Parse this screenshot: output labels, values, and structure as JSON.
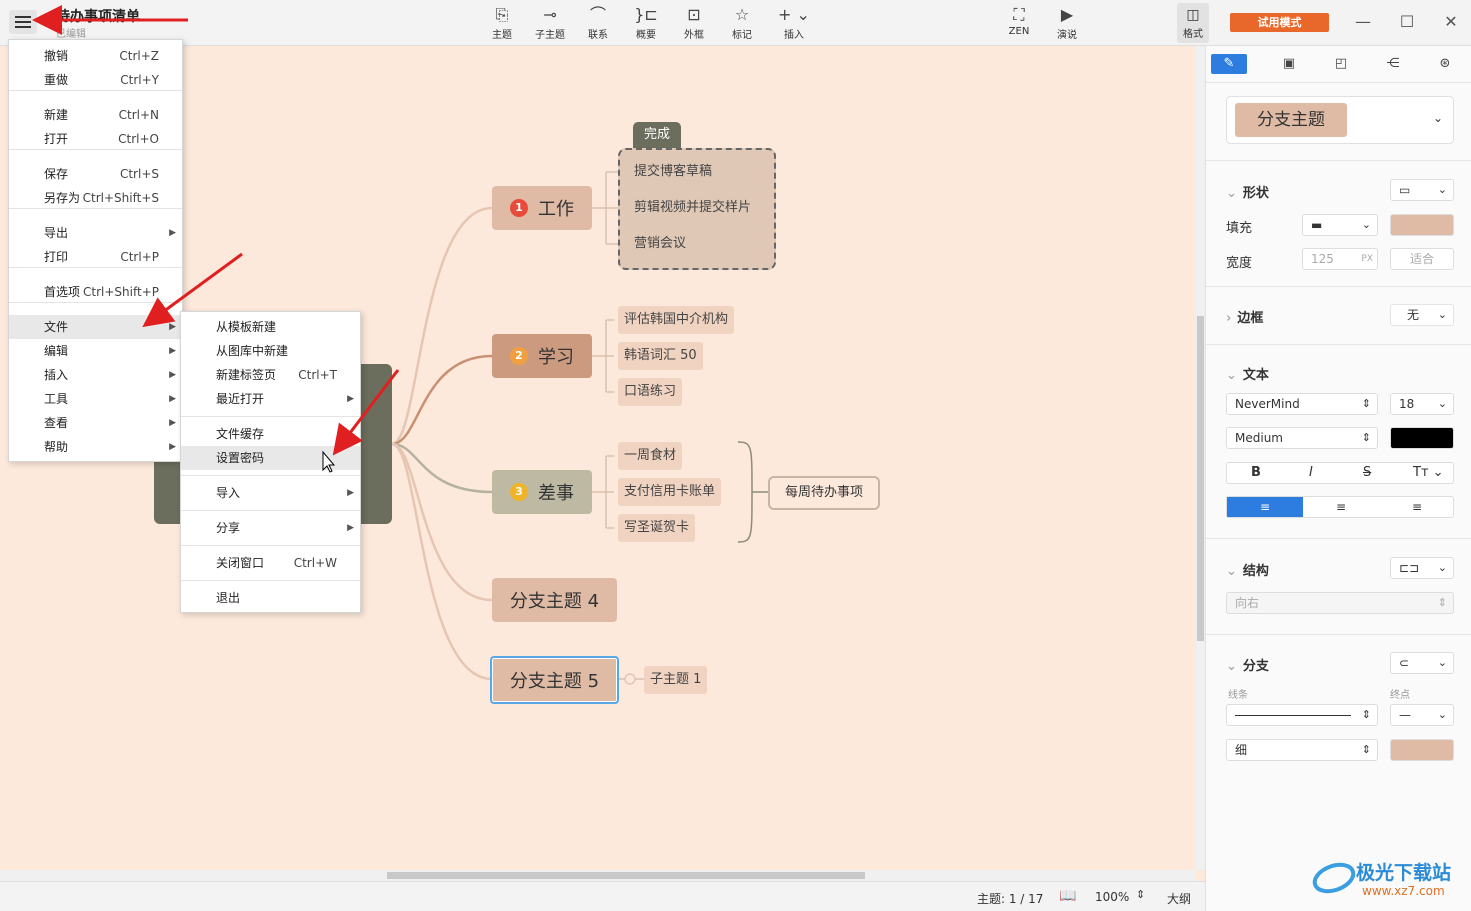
{
  "window": {
    "title": "待办事项清单",
    "status": "已编辑"
  },
  "toolbar": [
    {
      "icon": "topic-icon",
      "label": "主题"
    },
    {
      "icon": "subtopic-icon",
      "label": "子主题"
    },
    {
      "icon": "relationship-icon",
      "label": "联系"
    },
    {
      "icon": "summary-icon",
      "label": "概要"
    },
    {
      "icon": "boundary-icon",
      "label": "外框"
    },
    {
      "icon": "marker-icon",
      "label": "标记"
    },
    {
      "icon": "insert-icon",
      "label": "插入"
    },
    {
      "icon": "zen-icon",
      "label": "ZEN"
    },
    {
      "icon": "presentation-icon",
      "label": "演说"
    },
    {
      "icon": "format-panel-icon",
      "label": "格式"
    }
  ],
  "trial_label": "试用模式",
  "main_menu": [
    {
      "label": "撤销",
      "shortcut": "Ctrl+Z"
    },
    {
      "label": "重做",
      "shortcut": "Ctrl+Y"
    },
    {
      "label": "新建",
      "shortcut": "Ctrl+N"
    },
    {
      "label": "打开",
      "shortcut": "Ctrl+O"
    },
    {
      "label": "保存",
      "shortcut": "Ctrl+S"
    },
    {
      "label": "另存为",
      "shortcut": "Ctrl+Shift+S"
    },
    {
      "label": "导出",
      "shortcut": ""
    },
    {
      "label": "打印",
      "shortcut": "Ctrl+P"
    },
    {
      "label": "首选项",
      "shortcut": "Ctrl+Shift+P"
    },
    {
      "label": "文件",
      "shortcut": ""
    },
    {
      "label": "编辑",
      "shortcut": ""
    },
    {
      "label": "插入",
      "shortcut": ""
    },
    {
      "label": "工具",
      "shortcut": ""
    },
    {
      "label": "查看",
      "shortcut": ""
    },
    {
      "label": "帮助",
      "shortcut": ""
    }
  ],
  "file_submenu": [
    {
      "label": "从模板新建",
      "shortcut": ""
    },
    {
      "label": "从图库中新建",
      "shortcut": ""
    },
    {
      "label": "新建标签页",
      "shortcut": "Ctrl+T"
    },
    {
      "label": "最近打开",
      "shortcut": ""
    },
    {
      "label": "文件缓存",
      "shortcut": ""
    },
    {
      "label": "设置密码",
      "shortcut": ""
    },
    {
      "label": "导入",
      "shortcut": ""
    },
    {
      "label": "分享",
      "shortcut": ""
    },
    {
      "label": "关闭窗口",
      "shortcut": "Ctrl+W"
    },
    {
      "label": "退出",
      "shortcut": ""
    }
  ],
  "mindmap": {
    "branches": [
      {
        "number": "1",
        "label": "工作",
        "color": "#e84b3c",
        "children": [
          "提交博客草稿",
          "剪辑视频并提交样片",
          "营销会议"
        ],
        "boundary_label": "完成"
      },
      {
        "number": "2",
        "label": "学习",
        "color": "#f0a040",
        "children": [
          "评估韩国中介机构",
          "韩语词汇 50",
          "口语练习"
        ]
      },
      {
        "number": "3",
        "label": "差事",
        "color": "#f0b429",
        "children": [
          "一周食材",
          "支付信用卡账单",
          "写圣诞贺卡"
        ],
        "summary": "每周待办事项"
      },
      {
        "label": "分支主题 4"
      },
      {
        "label": "分支主题 5",
        "children": [
          "子主题 1"
        ]
      }
    ]
  },
  "status_bar": {
    "topics_label": "主题: 1 / 17",
    "zoom": "100%",
    "outline_label": "大纲"
  },
  "format_panel": {
    "style_name": "分支主题",
    "shape_section": "形状",
    "fill_label": "填充",
    "fill_color": "#dfbba6",
    "width_label": "宽度",
    "width_value": "125",
    "width_unit": "PX",
    "fit_label": "适合",
    "border_section": "边框",
    "border_value": "无",
    "text_section": "文本",
    "font_family": "NeverMind",
    "font_size": "18",
    "font_weight": "Medium",
    "text_color": "#000000",
    "structure_section": "结构",
    "structure_value": "向右",
    "branch_section": "分支",
    "line_label": "线条",
    "endpoint_label": "终点",
    "line_width": "细",
    "line_color": "#dfbba6"
  },
  "watermark": {
    "name": "极光下载站",
    "url": "www.xz7.com"
  }
}
